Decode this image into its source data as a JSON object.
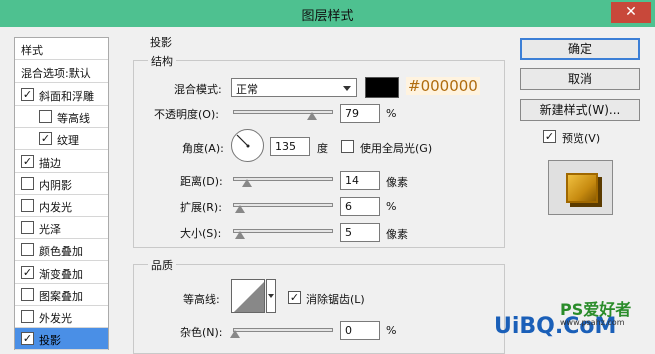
{
  "window": {
    "title": "图层样式",
    "close_glyph": "✕"
  },
  "left_panel": {
    "header": "样式",
    "blend_options": "混合选项:默认",
    "items": [
      {
        "label": "斜面和浮雕",
        "checked": true,
        "indent": false
      },
      {
        "label": "等高线",
        "checked": false,
        "indent": true
      },
      {
        "label": "纹理",
        "checked": true,
        "indent": true
      },
      {
        "label": "描边",
        "checked": true,
        "indent": false
      },
      {
        "label": "内阴影",
        "checked": false,
        "indent": false
      },
      {
        "label": "内发光",
        "checked": false,
        "indent": false
      },
      {
        "label": "光泽",
        "checked": false,
        "indent": false
      },
      {
        "label": "颜色叠加",
        "checked": false,
        "indent": false
      },
      {
        "label": "渐变叠加",
        "checked": true,
        "indent": false
      },
      {
        "label": "图案叠加",
        "checked": false,
        "indent": false
      },
      {
        "label": "外发光",
        "checked": false,
        "indent": false
      },
      {
        "label": "投影",
        "checked": true,
        "indent": false,
        "selected": true
      }
    ]
  },
  "shadow_section": {
    "title": "投影",
    "structure": {
      "title": "结构",
      "blend_mode_label": "混合模式:",
      "blend_mode_value": "正常",
      "color_hex": "#000000",
      "color_annotation": "#000000",
      "opacity_label": "不透明度(O):",
      "opacity_value": "79",
      "opacity_fraction": 0.79,
      "opacity_unit": "%",
      "angle_label": "角度(A):",
      "angle_value": "135",
      "angle_unit": "度",
      "global_light_label": "使用全局光(G)",
      "global_light_checked": false,
      "distance_label": "距离(D):",
      "distance_value": "14",
      "distance_unit": "像素",
      "spread_label": "扩展(R):",
      "spread_value": "6",
      "spread_unit": "%",
      "size_label": "大小(S):",
      "size_value": "5",
      "size_unit": "像素"
    },
    "quality": {
      "title": "品质",
      "contour_label": "等高线:",
      "antialias_label": "消除锯齿(L)",
      "antialias_checked": true,
      "noise_label": "杂色(N):",
      "noise_value": "0",
      "noise_unit": "%"
    }
  },
  "buttons": {
    "ok": "确定",
    "cancel": "取消",
    "new_style": "新建样式(W)...",
    "preview_label": "预览(V)",
    "preview_checked": true
  },
  "watermark": {
    "main": "UiBQ.CoM",
    "ps": "PS爱好者",
    "site": "www.psahz.com"
  },
  "colors": {
    "titlebar": "#4ec190",
    "selected": "#4a8fe6",
    "annotation": "#b06c0e"
  }
}
